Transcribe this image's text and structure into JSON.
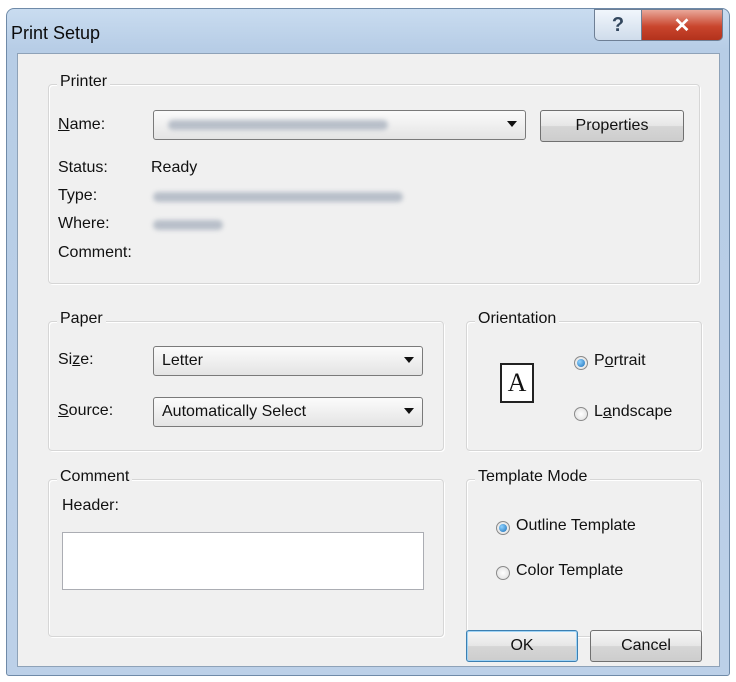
{
  "window": {
    "title": "Print Setup",
    "help_glyph": "?",
    "close_glyph": "✕"
  },
  "printer": {
    "legend": "Printer",
    "name_label": "Name:",
    "properties_label": "Properties",
    "status_label": "Status:",
    "status_value": "Ready",
    "type_label": "Type:",
    "where_label": "Where:",
    "comment_label": "Comment:"
  },
  "paper": {
    "legend": "Paper",
    "size_label": "Size:",
    "size_value": "Letter",
    "source_label": "Source:",
    "source_value": "Automatically Select"
  },
  "orientation": {
    "legend": "Orientation",
    "icon_letter": "A",
    "portrait_label": "Portrait",
    "landscape_label": "Landscape",
    "selected": "Portrait"
  },
  "comment": {
    "legend": "Comment",
    "header_label": "Header:",
    "header_value": ""
  },
  "template_mode": {
    "legend": "Template Mode",
    "outline_label": "Outline Template",
    "color_label": "Color Template",
    "selected": "Outline Template"
  },
  "buttons": {
    "ok": "OK",
    "cancel": "Cancel"
  }
}
